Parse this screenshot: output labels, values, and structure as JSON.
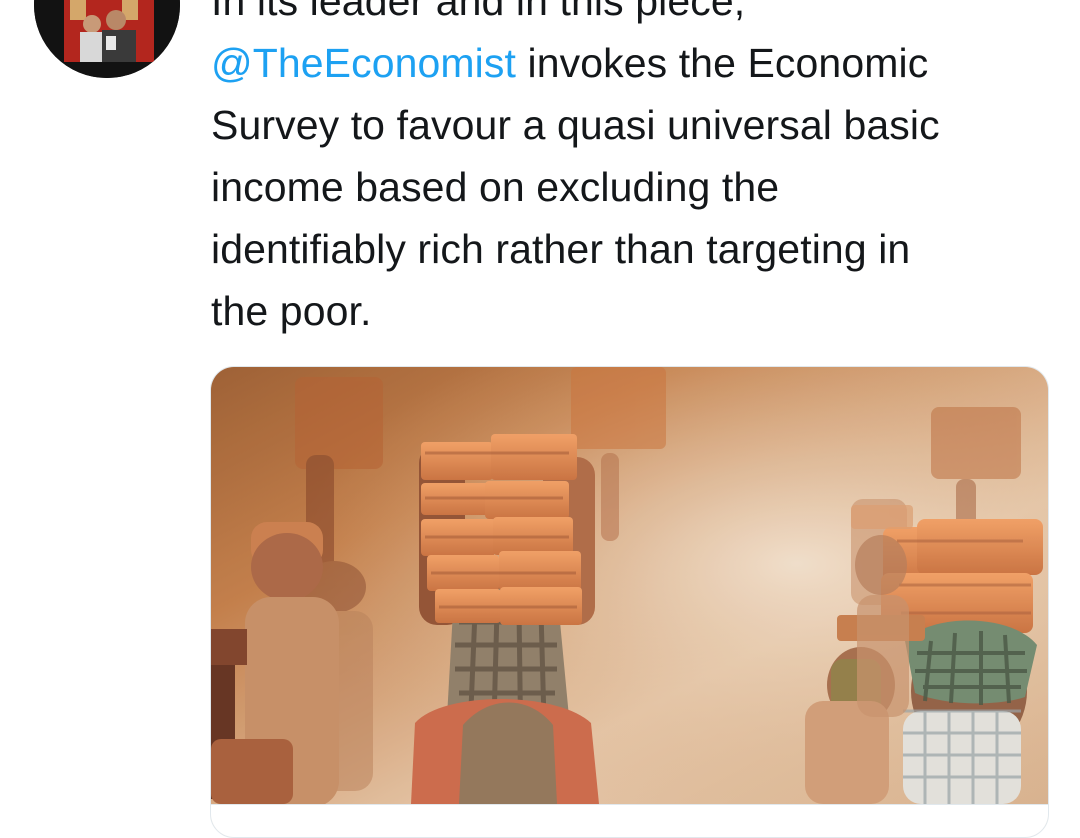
{
  "tweet": {
    "avatar_icon": "profile-photo-avatar",
    "text_lines": [
      "In its leader and in this piece,",
      "invokes the Economic",
      "Survey to favour a quasi universal basic",
      "income based on excluding the",
      "identifiably rich rather than targeting in",
      "the poor."
    ],
    "mention": "@TheEconomist",
    "colors": {
      "text": "#14171a",
      "mention": "#1da1f2"
    }
  },
  "media": {
    "image_icon": "photo-brick-carriers"
  }
}
